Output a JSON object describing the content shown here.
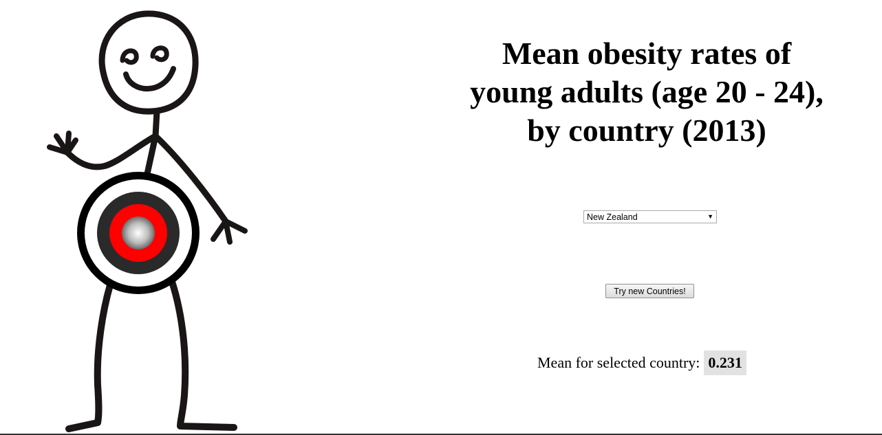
{
  "title_lines": [
    "Mean obesity rates of",
    "young adults (age 20 - 24),",
    "by country (2013)"
  ],
  "country_select": {
    "selected": "New Zealand"
  },
  "try_button_label": "Try new Countries!",
  "mean": {
    "label": "Mean for selected country:",
    "value": "0.231"
  },
  "illustration": {
    "name": "stick-figure-with-target-belly",
    "colors": {
      "line": "#1a1616",
      "target_outer": "#000000",
      "target_ring": "#ffffff",
      "target_dark": "#2a2a2a",
      "target_red": "#ff0000",
      "target_center": "#9a9a9a"
    }
  }
}
